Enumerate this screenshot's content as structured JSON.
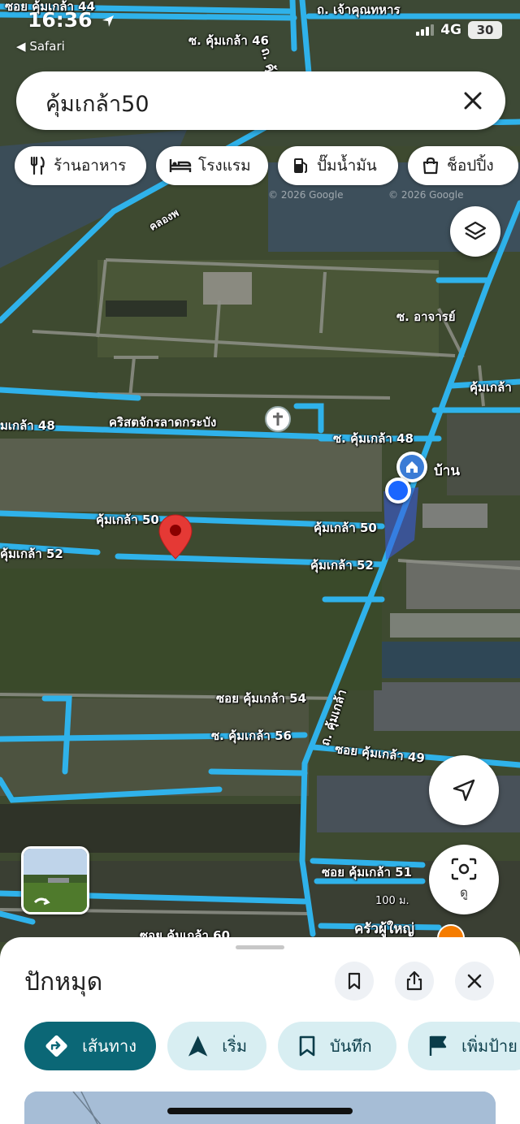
{
  "status_bar": {
    "time": "16:36",
    "back_label": "Safari",
    "network": "4G",
    "battery": "30"
  },
  "search": {
    "query": "คุ้มเกล้า50"
  },
  "chips": [
    {
      "label": "ร้านอาหาร",
      "icon": "restaurant-icon"
    },
    {
      "label": "โรงแรม",
      "icon": "hotel-icon"
    },
    {
      "label": "ปั๊มน้ำมัน",
      "icon": "gas-station-icon"
    },
    {
      "label": "ช็อปปิ้ง",
      "icon": "shopping-bag-icon"
    }
  ],
  "map": {
    "labels": {
      "soi44": "ซอย คุ้มเกล้า 44",
      "chao_khun_thahan": "ถ. เจ้าคุณทหาร",
      "s46": "ซ. คุ้มเกล้า 46",
      "khumklao_road_top": "ถ. คุ้มเกล้า",
      "khlong": "คลองพ",
      "watermark_1": "© 2026 Google",
      "watermark_2": "© 2026 Google",
      "achan": "ซ. อาจารย์",
      "khumklao_right": "คุ้มเกล้า",
      "khumklao48_left": "มเกล้า 48",
      "church": "คริสตจักรลาดกระบัง",
      "s48": "ซ. คุ้มเกล้า 48",
      "home": "บ้าน",
      "k50_left": "คุ้มเกล้า 50",
      "k50_right": "คุ้มเกล้า 50",
      "k52_left": "คุ้มเกล้า 52",
      "k52_right": "คุ้มเกล้า 52",
      "soi54": "ซอย คุ้มเกล้า 54",
      "khumklao_road_mid": "ถ. คุ้มเกล้า",
      "s56": "ซ. คุ้มเกล้า 56",
      "soi49": "ซอย คุ้มเกล้า 49",
      "soi51": "ซอย คุ้มเกล้า 51",
      "scale": "100 ม.",
      "restaurant": "ครัวผู้ใหญ่",
      "bottom_partial": "ซอย คุ้มเกล้า 60"
    },
    "lens_label": "ดู"
  },
  "sheet": {
    "title": "ปักหมุด",
    "actions": [
      {
        "label": "เส้นทาง",
        "icon": "directions-icon"
      },
      {
        "label": "เริ่ม",
        "icon": "navigation-arrow-icon"
      },
      {
        "label": "บันทึก",
        "icon": "bookmark-icon"
      },
      {
        "label": "เพิ่มป้าย",
        "icon": "flag-icon"
      }
    ]
  },
  "colors": {
    "road": "#2fb2ea",
    "pin": "#e53935",
    "primary_action": "#0b6776",
    "secondary_action": "#d8eef2",
    "location_dot": "#1a66ff"
  }
}
